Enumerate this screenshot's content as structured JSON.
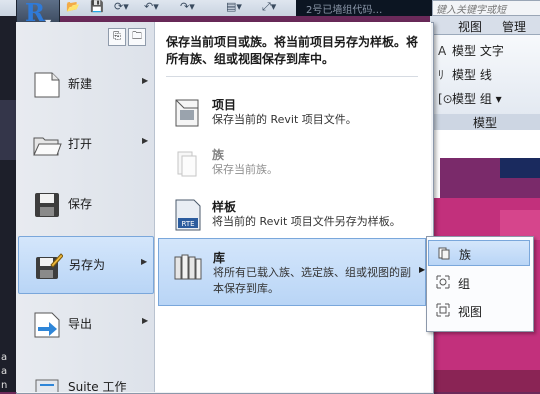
{
  "quick_access": {
    "title_text": "2号已墙组代码…",
    "search_placeholder": "键入关键字或短"
  },
  "ribbon": {
    "tabs": [
      "视图",
      "管理"
    ],
    "items": [
      {
        "label": "模型 文字",
        "icon": "model-text-icon"
      },
      {
        "label": "模型 线",
        "icon": "model-line-icon"
      },
      {
        "label": "模型 组 ▾",
        "icon": "model-group-icon"
      }
    ],
    "panel_caption": "模型"
  },
  "left_strip": {
    "labels": [
      "a",
      "a",
      "n"
    ]
  },
  "menu": {
    "items": [
      {
        "label": "新建",
        "icon": "new-document-icon",
        "has_arrow": true
      },
      {
        "label": "打开",
        "icon": "open-folder-icon",
        "has_arrow": true
      },
      {
        "label": "保存",
        "icon": "save-disk-icon",
        "has_arrow": false
      },
      {
        "label": "另存为",
        "icon": "save-as-icon",
        "has_arrow": true,
        "selected": true
      },
      {
        "label": "导出",
        "icon": "export-icon",
        "has_arrow": true
      },
      {
        "label": "Suite 工作",
        "icon": "suite-workflow-icon",
        "has_arrow": false
      }
    ],
    "recent_buttons": [
      "recent-documents-icon",
      "open-documents-icon"
    ]
  },
  "submenu": {
    "header": "保存当前项目或族。将当前项目另存为样板。将所有族、组或视图保存到库中。",
    "items": [
      {
        "title": "项目",
        "desc": "保存当前的 Revit 项目文件。",
        "icon": "project-file-icon",
        "enabled": true
      },
      {
        "title": "族",
        "desc": "保存当前族。",
        "icon": "family-icon",
        "enabled": false
      },
      {
        "title": "样板",
        "desc": "将当前的 Revit 项目文件另存为样板。",
        "icon": "template-rte-icon",
        "enabled": true,
        "icon_text": "RTE"
      },
      {
        "title": "库",
        "desc": "将所有已载入族、选定族、组或视图的副本保存到库。",
        "icon": "library-books-icon",
        "enabled": true,
        "selected": true
      }
    ]
  },
  "flyout": {
    "items": [
      {
        "label": "族",
        "icon": "family-small-icon",
        "selected": true
      },
      {
        "label": "组",
        "icon": "group-small-icon"
      },
      {
        "label": "视图",
        "icon": "view-small-icon"
      }
    ]
  },
  "colors": {
    "accent_selected": "#b9d5f6",
    "accent_border": "#7aa7db",
    "menu_bg": "#f0f2f5",
    "canvas_magenta": "#7a2a6a"
  }
}
